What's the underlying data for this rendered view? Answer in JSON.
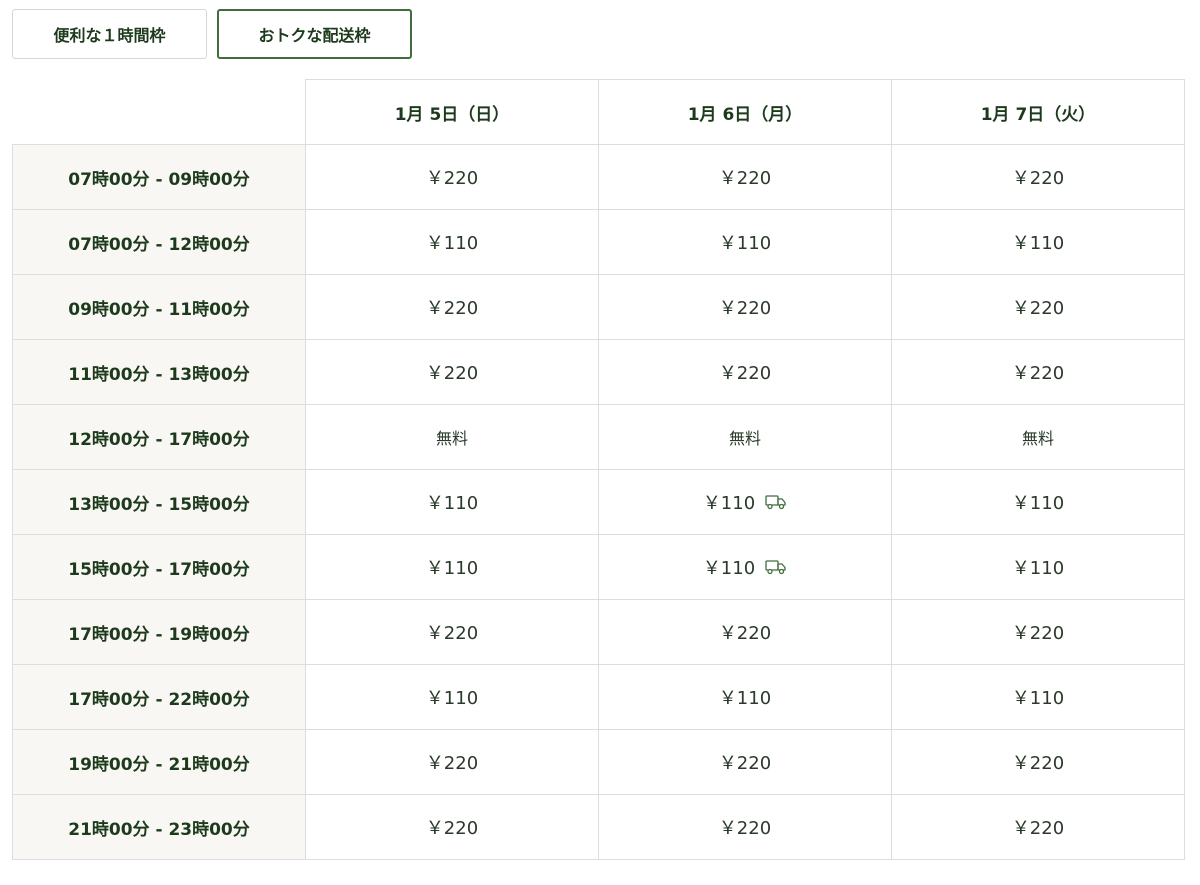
{
  "tabs": [
    {
      "label": "便利な１時間枠",
      "selected": false
    },
    {
      "label": "おトクな配送枠",
      "selected": true
    }
  ],
  "colors": {
    "text": "#1d3a1c",
    "accent": "#3f6e3c",
    "header_bg": "#f8f7f4",
    "border": "#dddddd"
  },
  "table": {
    "dates": [
      "1月 5日（日）",
      "1月 6日（月）",
      "1月 7日（火）"
    ],
    "rows": [
      {
        "time": "07時00分 - 09時00分",
        "cells": [
          {
            "price": "￥220"
          },
          {
            "price": "￥220"
          },
          {
            "price": "￥220"
          }
        ]
      },
      {
        "time": "07時00分 - 12時00分",
        "cells": [
          {
            "price": "￥110"
          },
          {
            "price": "￥110"
          },
          {
            "price": "￥110"
          }
        ]
      },
      {
        "time": "09時00分 - 11時00分",
        "cells": [
          {
            "price": "￥220"
          },
          {
            "price": "￥220"
          },
          {
            "price": "￥220"
          }
        ]
      },
      {
        "time": "11時00分 - 13時00分",
        "cells": [
          {
            "price": "￥220"
          },
          {
            "price": "￥220"
          },
          {
            "price": "￥220"
          }
        ]
      },
      {
        "time": "12時00分 - 17時00分",
        "cells": [
          {
            "price": "無料"
          },
          {
            "price": "無料"
          },
          {
            "price": "無料"
          }
        ]
      },
      {
        "time": "13時00分 - 15時00分",
        "cells": [
          {
            "price": "￥110"
          },
          {
            "price": "￥110",
            "icon": "delivery-truck-icon"
          },
          {
            "price": "￥110"
          }
        ]
      },
      {
        "time": "15時00分 - 17時00分",
        "cells": [
          {
            "price": "￥110"
          },
          {
            "price": "￥110",
            "icon": "delivery-truck-icon"
          },
          {
            "price": "￥110"
          }
        ]
      },
      {
        "time": "17時00分 - 19時00分",
        "cells": [
          {
            "price": "￥220"
          },
          {
            "price": "￥220"
          },
          {
            "price": "￥220"
          }
        ]
      },
      {
        "time": "17時00分 - 22時00分",
        "cells": [
          {
            "price": "￥110"
          },
          {
            "price": "￥110"
          },
          {
            "price": "￥110"
          }
        ]
      },
      {
        "time": "19時00分 - 21時00分",
        "cells": [
          {
            "price": "￥220"
          },
          {
            "price": "￥220"
          },
          {
            "price": "￥220"
          }
        ]
      },
      {
        "time": "21時00分 - 23時00分",
        "cells": [
          {
            "price": "￥220"
          },
          {
            "price": "￥220"
          },
          {
            "price": "￥220"
          }
        ]
      }
    ]
  }
}
